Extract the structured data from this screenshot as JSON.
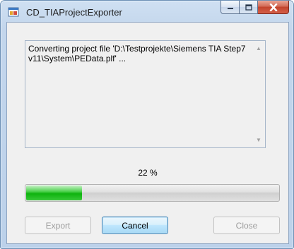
{
  "window": {
    "title": "CD_TIAProjectExporter"
  },
  "caption_buttons": {
    "minimize": "minimize-icon",
    "maximize": "maximize-icon",
    "close": "close-icon"
  },
  "log": {
    "text": "Converting project file 'D:\\Testprojekte\\Siemens TIA Step7 v11\\System\\PEData.plf' ..."
  },
  "progress": {
    "label": "22 %",
    "value": 0.22
  },
  "buttons": {
    "export": "Export",
    "cancel": "Cancel",
    "close": "Close"
  },
  "colors": {
    "progress_fill": "#0eb30e",
    "close_button": "#c2432c"
  }
}
